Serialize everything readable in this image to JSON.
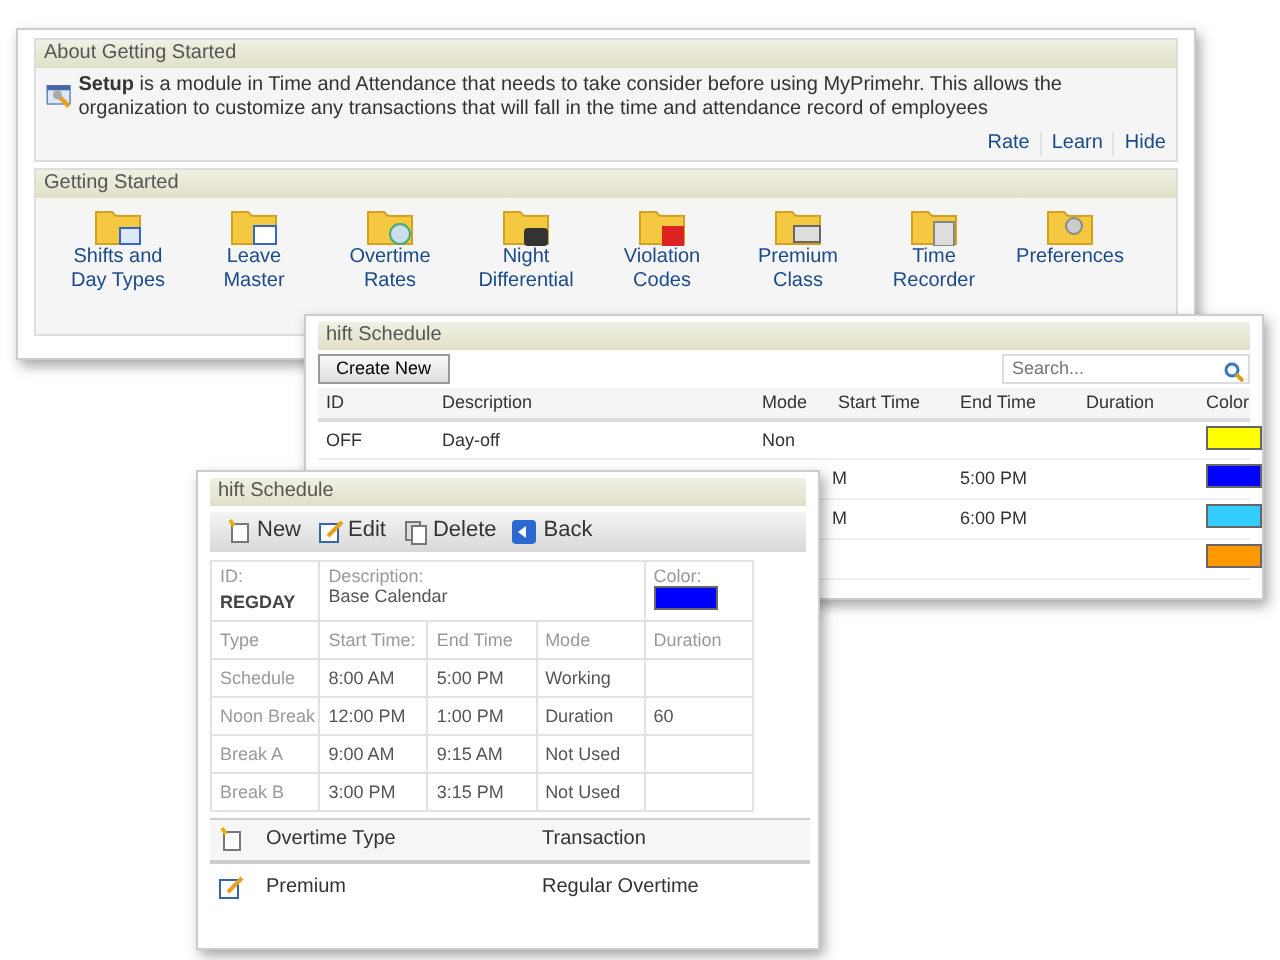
{
  "about_panel": {
    "title": "About Getting Started",
    "description": "**Setup** is a module in Time and Attendance that needs to take consider before using MyPrimehr. This allows the organization to customize any transactions that will fall in the time and attendance record of employees",
    "links": [
      "Rate",
      "Learn",
      "Hide"
    ]
  },
  "getting_started": {
    "title": "Getting Started",
    "items": [
      {
        "label": "Shifts and Day Types",
        "kind": "shifts"
      },
      {
        "label": "Leave Master",
        "kind": "leave"
      },
      {
        "label": "Overtime Rates",
        "kind": "overtime"
      },
      {
        "label": "Night Differential",
        "kind": "night"
      },
      {
        "label": "Violation Codes",
        "kind": "violation"
      },
      {
        "label": "Premium Class",
        "kind": "premium"
      },
      {
        "label": "Time Recorder",
        "kind": "recorder"
      },
      {
        "label": "Preferences",
        "kind": "preferences"
      }
    ]
  },
  "shift_list_window": {
    "title": "hift Schedule",
    "create_button": "Create New",
    "search": {
      "placeholder": "Search..."
    },
    "columns": [
      "ID",
      "Description",
      "Mode",
      "Start Time",
      "End Time",
      "Duration",
      "Color"
    ],
    "rows": [
      {
        "id": "OFF",
        "description": "Day-off",
        "mode": "Non",
        "color": "#ffff00"
      },
      {
        "start_time": "M",
        "end_time": "5:00 PM",
        "color": "#0000ff"
      },
      {
        "start_time": "M",
        "end_time": "6:00 PM",
        "color": "#33ccff"
      },
      {
        "color": "#ff9900"
      }
    ]
  },
  "shift_detail_window": {
    "title": "hift Schedule",
    "toolbar": [
      {
        "label": "New",
        "kind": "new"
      },
      {
        "label": "Edit",
        "kind": "edit"
      },
      {
        "label": "Delete",
        "kind": "delete"
      },
      {
        "label": "Back",
        "kind": "back"
      }
    ],
    "id_label": "ID:",
    "id": "REGDAY",
    "description_label": "Description:",
    "description": "Base Calendar",
    "color_label": "Color:",
    "color": "#0000ff",
    "schedule_columns": [
      "Type",
      "Start Time:",
      "End Time",
      "Mode",
      "Duration"
    ],
    "schedule_rows": [
      {
        "type": "Schedule",
        "start": "8:00 AM",
        "end": "5:00 PM",
        "mode": "Working"
      },
      {
        "type": "Noon Break",
        "start": "12:00 PM",
        "end": "1:00 PM",
        "mode": "Duration",
        "duration": "60"
      },
      {
        "type": "Break A",
        "start": "9:00 AM",
        "end": "9:15 AM",
        "mode": "Not Used"
      },
      {
        "type": "Break B",
        "start": "3:00 PM",
        "end": "3:15 PM",
        "mode": "Not Used"
      }
    ],
    "overtime_columns": [
      "Overtime Type",
      "Transaction"
    ],
    "overtime_rows": [
      {
        "type": "Premium",
        "transaction": "Regular Overtime"
      }
    ]
  }
}
